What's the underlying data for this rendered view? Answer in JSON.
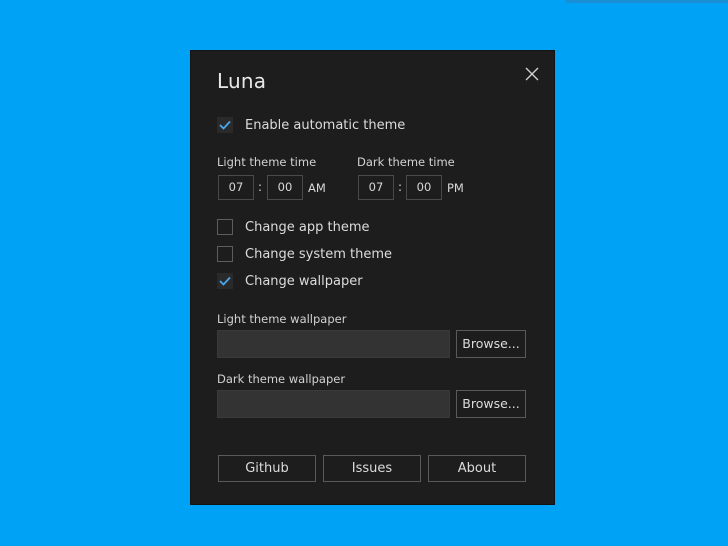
{
  "window": {
    "title": "Luna"
  },
  "options": {
    "enable_automatic_theme": {
      "label": "Enable automatic theme",
      "checked": true
    },
    "change_app_theme": {
      "label": "Change app theme",
      "checked": false
    },
    "change_system_theme": {
      "label": "Change system theme",
      "checked": false
    },
    "change_wallpaper": {
      "label": "Change wallpaper",
      "checked": true
    }
  },
  "light_time": {
    "label": "Light theme time",
    "hour": "07",
    "minute": "00",
    "separator": ":",
    "period": "AM"
  },
  "dark_time": {
    "label": "Dark theme time",
    "hour": "07",
    "minute": "00",
    "separator": ":",
    "period": "PM"
  },
  "light_wallpaper": {
    "label": "Light theme wallpaper",
    "path": "",
    "browse_label": "Browse..."
  },
  "dark_wallpaper": {
    "label": "Dark theme wallpaper",
    "path": "",
    "browse_label": "Browse..."
  },
  "footer": {
    "github_label": "Github",
    "issues_label": "Issues",
    "about_label": "About"
  },
  "colors": {
    "desktop_background": "#00a2f5",
    "window_background": "#1d1d1d",
    "accent_check": "#4aa8f0"
  },
  "icons": {
    "close": "close-icon",
    "check": "checkmark-icon"
  }
}
